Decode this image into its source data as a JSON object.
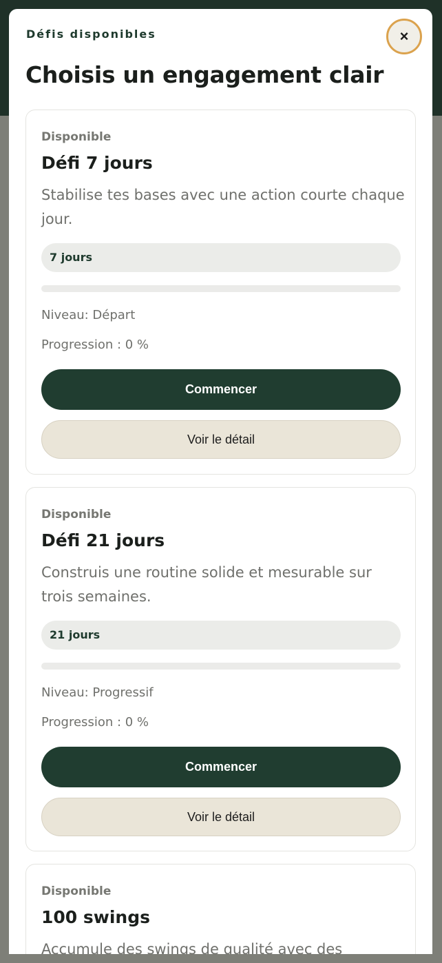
{
  "modal": {
    "eyebrow": "Défis disponibles",
    "title": "Choisis un engagement clair",
    "close_icon": "×"
  },
  "cards": [
    {
      "status": "Disponible",
      "title": "Défi 7 jours",
      "description": "Stabilise tes bases avec une action courte chaque jour.",
      "duration": "7 jours",
      "progress_value": 0,
      "level": "Niveau: Départ",
      "progress_text": "Progression : 0 %",
      "start_label": "Commencer",
      "detail_label": "Voir le détail"
    },
    {
      "status": "Disponible",
      "title": "Défi 21 jours",
      "description": "Construis une routine solide et mesurable sur trois semaines.",
      "duration": "21 jours",
      "progress_value": 0,
      "level": "Niveau: Progressif",
      "progress_text": "Progression : 0 %",
      "start_label": "Commencer",
      "detail_label": "Voir le détail"
    },
    {
      "status": "Disponible",
      "title": "100 swings",
      "description": "Accumule des swings de qualité avec des"
    }
  ],
  "colors": {
    "brand_dark": "#203d30",
    "close_ring": "#dba24d",
    "detail_bg": "#eae5d8"
  }
}
